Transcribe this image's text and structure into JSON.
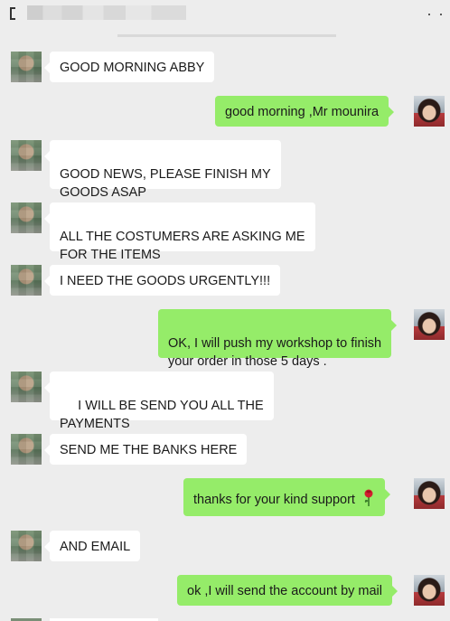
{
  "header": {
    "back_icon": "chevron-left-icon",
    "more_icon": "more-horizontal-icon",
    "more_glyph": "· ·"
  },
  "messages": [
    {
      "side": "in",
      "text": "GOOD MORNING ABBY"
    },
    {
      "side": "out",
      "text": "good morning ,Mr mounira"
    },
    {
      "side": "in",
      "text": "GOOD NEWS,  PLEASE FINISH MY\nGOODS ASAP"
    },
    {
      "side": "in",
      "text": "ALL THE COSTUMERS ARE ASKING ME\nFOR THE ITEMS"
    },
    {
      "side": "in",
      "text": "I NEED THE GOODS URGENTLY!!!"
    },
    {
      "side": "out",
      "text": "OK, I will push my workshop to finish\nyour order in those 5 days ."
    },
    {
      "side": "in",
      "text": " I WILL BE SEND YOU ALL THE\nPAYMENTS"
    },
    {
      "side": "in",
      "text": "SEND ME THE BANKS HERE"
    },
    {
      "side": "out",
      "text": "thanks for your kind support",
      "emoji": "rose-icon"
    },
    {
      "side": "in",
      "text": "AND EMAIL"
    },
    {
      "side": "out",
      "text": "ok ,I will send the account by mail"
    }
  ],
  "colors": {
    "background": "#ededed",
    "incoming_bubble": "#ffffff",
    "outgoing_bubble": "#95ec69"
  }
}
